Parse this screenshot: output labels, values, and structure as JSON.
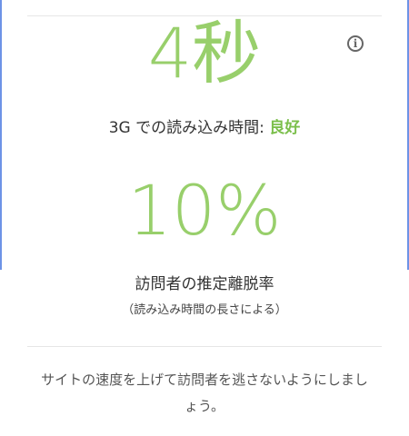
{
  "metric": {
    "load_time": "4秒",
    "load_label": "3G での読み込み時間: ",
    "rating": "良好",
    "bounce_rate": "10%",
    "bounce_label": "訪問者の推定離脱率",
    "bounce_sub": "（読み込み時間の長さによる）"
  },
  "message": "サイトの速度を上げて訪問者を逃さないようにしましょう。",
  "icons": {
    "info": "info-icon"
  },
  "colors": {
    "accent": "#98cf6b",
    "rating": "#7bbf4b",
    "edge": "#6d93e6"
  }
}
